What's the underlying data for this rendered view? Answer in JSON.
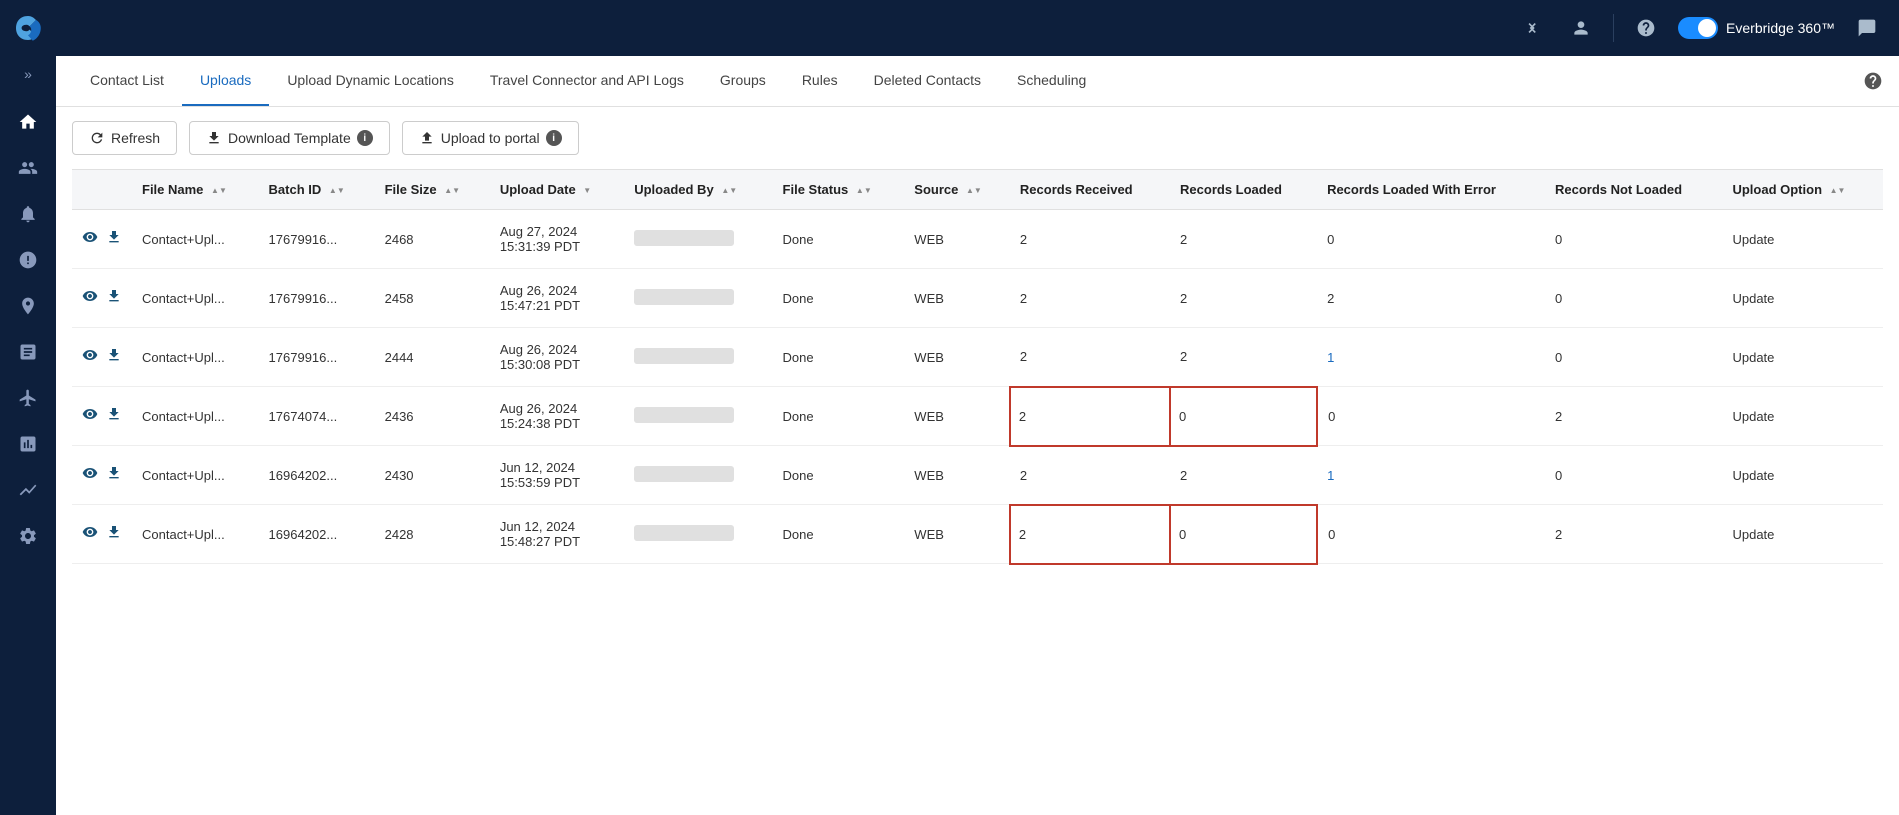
{
  "topbar": {
    "collapse_icon": "«",
    "user_icon": "user",
    "help_icon": "?",
    "toggle_label": "Everbridge 360™",
    "chat_icon": "💬"
  },
  "sidebar": {
    "logo_alt": "Everbridge",
    "items": [
      {
        "id": "home",
        "icon": "home",
        "label": "Home"
      },
      {
        "id": "contacts",
        "icon": "contacts",
        "label": "Contacts"
      },
      {
        "id": "alerts",
        "icon": "alerts",
        "label": "Alerts"
      },
      {
        "id": "incidents",
        "icon": "incidents",
        "label": "Incidents"
      },
      {
        "id": "locations",
        "icon": "locations",
        "label": "Locations"
      },
      {
        "id": "reports",
        "icon": "reports",
        "label": "Reports"
      },
      {
        "id": "travel",
        "icon": "travel",
        "label": "Travel"
      },
      {
        "id": "analytics",
        "icon": "analytics",
        "label": "Analytics"
      },
      {
        "id": "chart",
        "icon": "chart",
        "label": "Chart"
      },
      {
        "id": "settings",
        "icon": "settings",
        "label": "Settings"
      }
    ]
  },
  "tabs": [
    {
      "id": "contact-list",
      "label": "Contact List"
    },
    {
      "id": "uploads",
      "label": "Uploads",
      "active": true
    },
    {
      "id": "upload-dynamic",
      "label": "Upload Dynamic Locations"
    },
    {
      "id": "travel-connector",
      "label": "Travel Connector and API Logs"
    },
    {
      "id": "groups",
      "label": "Groups"
    },
    {
      "id": "rules",
      "label": "Rules"
    },
    {
      "id": "deleted-contacts",
      "label": "Deleted Contacts"
    },
    {
      "id": "scheduling",
      "label": "Scheduling"
    }
  ],
  "toolbar": {
    "refresh_label": "Refresh",
    "download_label": "Download Template",
    "upload_label": "Upload to portal"
  },
  "table": {
    "columns": [
      {
        "id": "file-name",
        "label": "File Name",
        "sortable": true
      },
      {
        "id": "batch-id",
        "label": "Batch ID",
        "sortable": true
      },
      {
        "id": "file-size",
        "label": "File Size",
        "sortable": true
      },
      {
        "id": "upload-date",
        "label": "Upload Date",
        "sortable": true,
        "sort_active": true
      },
      {
        "id": "uploaded-by",
        "label": "Uploaded By",
        "sortable": true
      },
      {
        "id": "file-status",
        "label": "File Status",
        "sortable": true
      },
      {
        "id": "source",
        "label": "Source",
        "sortable": true
      },
      {
        "id": "records-received",
        "label": "Records Received"
      },
      {
        "id": "records-loaded",
        "label": "Records Loaded"
      },
      {
        "id": "records-loaded-with-error",
        "label": "Records Loaded With Error"
      },
      {
        "id": "records-not-loaded",
        "label": "Records Not Loaded"
      },
      {
        "id": "upload-option",
        "label": "Upload Option",
        "sortable": true
      }
    ],
    "rows": [
      {
        "file_name": "Contact+Upl...",
        "batch_id": "17679916...",
        "file_size": "2468",
        "upload_date": "Aug 27, 2024\n15:31:39 PDT",
        "file_status": "Done",
        "source": "WEB",
        "records_received": "2",
        "records_loaded": "2",
        "records_loaded_with_error": "0",
        "records_not_loaded": "0",
        "upload_option": "Update",
        "highlight_records": false,
        "error_color": false
      },
      {
        "file_name": "Contact+Upl...",
        "batch_id": "17679916...",
        "file_size": "2458",
        "upload_date": "Aug 26, 2024\n15:47:21 PDT",
        "file_status": "Done",
        "source": "WEB",
        "records_received": "2",
        "records_loaded": "2",
        "records_loaded_with_error": "2",
        "records_not_loaded": "0",
        "upload_option": "Update",
        "highlight_records": false,
        "error_color": false
      },
      {
        "file_name": "Contact+Upl...",
        "batch_id": "17679916...",
        "file_size": "2444",
        "upload_date": "Aug 26, 2024\n15:30:08 PDT",
        "file_status": "Done",
        "source": "WEB",
        "records_received": "2",
        "records_loaded": "2",
        "records_loaded_with_error": "1",
        "records_not_loaded": "0",
        "upload_option": "Update",
        "highlight_records": false,
        "error_color": true
      },
      {
        "file_name": "Contact+Upl...",
        "batch_id": "17674074...",
        "file_size": "2436",
        "upload_date": "Aug 26, 2024\n15:24:38 PDT",
        "file_status": "Done",
        "source": "WEB",
        "records_received": "2",
        "records_loaded": "0",
        "records_loaded_with_error": "0",
        "records_not_loaded": "2",
        "upload_option": "Update",
        "highlight_records": true,
        "error_color": false
      },
      {
        "file_name": "Contact+Upl...",
        "batch_id": "16964202...",
        "file_size": "2430",
        "upload_date": "Jun 12, 2024\n15:53:59 PDT",
        "file_status": "Done",
        "source": "WEB",
        "records_received": "2",
        "records_loaded": "2",
        "records_loaded_with_error": "1",
        "records_not_loaded": "0",
        "upload_option": "Update",
        "highlight_records": false,
        "error_color": true
      },
      {
        "file_name": "Contact+Upl...",
        "batch_id": "16964202...",
        "file_size": "2428",
        "upload_date": "Jun 12, 2024\n15:48:27 PDT",
        "file_status": "Done",
        "source": "WEB",
        "records_received": "2",
        "records_loaded": "0",
        "records_loaded_with_error": "0",
        "records_not_loaded": "2",
        "upload_option": "Update",
        "highlight_records": true,
        "error_color": false
      }
    ]
  }
}
